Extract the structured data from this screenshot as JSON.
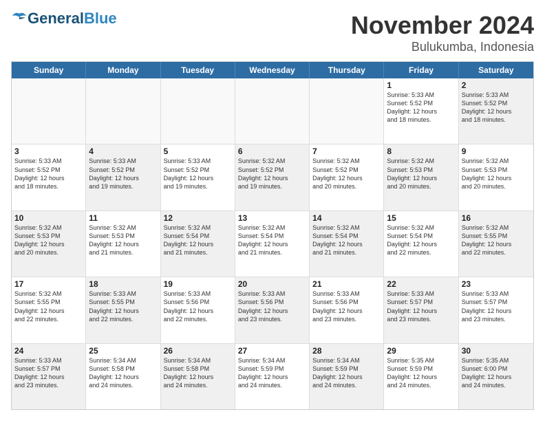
{
  "logo": {
    "text_general": "General",
    "text_blue": "Blue"
  },
  "title": "November 2024",
  "subtitle": "Bulukumba, Indonesia",
  "header_days": [
    "Sunday",
    "Monday",
    "Tuesday",
    "Wednesday",
    "Thursday",
    "Friday",
    "Saturday"
  ],
  "weeks": [
    [
      {
        "day": "",
        "info": "",
        "shaded": true
      },
      {
        "day": "",
        "info": "",
        "shaded": true
      },
      {
        "day": "",
        "info": "",
        "shaded": true
      },
      {
        "day": "",
        "info": "",
        "shaded": true
      },
      {
        "day": "",
        "info": "",
        "shaded": true
      },
      {
        "day": "1",
        "info": "Sunrise: 5:33 AM\nSunset: 5:52 PM\nDaylight: 12 hours\nand 18 minutes.",
        "shaded": false
      },
      {
        "day": "2",
        "info": "Sunrise: 5:33 AM\nSunset: 5:52 PM\nDaylight: 12 hours\nand 18 minutes.",
        "shaded": true
      }
    ],
    [
      {
        "day": "3",
        "info": "Sunrise: 5:33 AM\nSunset: 5:52 PM\nDaylight: 12 hours\nand 18 minutes.",
        "shaded": false
      },
      {
        "day": "4",
        "info": "Sunrise: 5:33 AM\nSunset: 5:52 PM\nDaylight: 12 hours\nand 19 minutes.",
        "shaded": true
      },
      {
        "day": "5",
        "info": "Sunrise: 5:33 AM\nSunset: 5:52 PM\nDaylight: 12 hours\nand 19 minutes.",
        "shaded": false
      },
      {
        "day": "6",
        "info": "Sunrise: 5:32 AM\nSunset: 5:52 PM\nDaylight: 12 hours\nand 19 minutes.",
        "shaded": true
      },
      {
        "day": "7",
        "info": "Sunrise: 5:32 AM\nSunset: 5:52 PM\nDaylight: 12 hours\nand 20 minutes.",
        "shaded": false
      },
      {
        "day": "8",
        "info": "Sunrise: 5:32 AM\nSunset: 5:53 PM\nDaylight: 12 hours\nand 20 minutes.",
        "shaded": true
      },
      {
        "day": "9",
        "info": "Sunrise: 5:32 AM\nSunset: 5:53 PM\nDaylight: 12 hours\nand 20 minutes.",
        "shaded": false
      }
    ],
    [
      {
        "day": "10",
        "info": "Sunrise: 5:32 AM\nSunset: 5:53 PM\nDaylight: 12 hours\nand 20 minutes.",
        "shaded": true
      },
      {
        "day": "11",
        "info": "Sunrise: 5:32 AM\nSunset: 5:53 PM\nDaylight: 12 hours\nand 21 minutes.",
        "shaded": false
      },
      {
        "day": "12",
        "info": "Sunrise: 5:32 AM\nSunset: 5:54 PM\nDaylight: 12 hours\nand 21 minutes.",
        "shaded": true
      },
      {
        "day": "13",
        "info": "Sunrise: 5:32 AM\nSunset: 5:54 PM\nDaylight: 12 hours\nand 21 minutes.",
        "shaded": false
      },
      {
        "day": "14",
        "info": "Sunrise: 5:32 AM\nSunset: 5:54 PM\nDaylight: 12 hours\nand 21 minutes.",
        "shaded": true
      },
      {
        "day": "15",
        "info": "Sunrise: 5:32 AM\nSunset: 5:54 PM\nDaylight: 12 hours\nand 22 minutes.",
        "shaded": false
      },
      {
        "day": "16",
        "info": "Sunrise: 5:32 AM\nSunset: 5:55 PM\nDaylight: 12 hours\nand 22 minutes.",
        "shaded": true
      }
    ],
    [
      {
        "day": "17",
        "info": "Sunrise: 5:32 AM\nSunset: 5:55 PM\nDaylight: 12 hours\nand 22 minutes.",
        "shaded": false
      },
      {
        "day": "18",
        "info": "Sunrise: 5:33 AM\nSunset: 5:55 PM\nDaylight: 12 hours\nand 22 minutes.",
        "shaded": true
      },
      {
        "day": "19",
        "info": "Sunrise: 5:33 AM\nSunset: 5:56 PM\nDaylight: 12 hours\nand 22 minutes.",
        "shaded": false
      },
      {
        "day": "20",
        "info": "Sunrise: 5:33 AM\nSunset: 5:56 PM\nDaylight: 12 hours\nand 23 minutes.",
        "shaded": true
      },
      {
        "day": "21",
        "info": "Sunrise: 5:33 AM\nSunset: 5:56 PM\nDaylight: 12 hours\nand 23 minutes.",
        "shaded": false
      },
      {
        "day": "22",
        "info": "Sunrise: 5:33 AM\nSunset: 5:57 PM\nDaylight: 12 hours\nand 23 minutes.",
        "shaded": true
      },
      {
        "day": "23",
        "info": "Sunrise: 5:33 AM\nSunset: 5:57 PM\nDaylight: 12 hours\nand 23 minutes.",
        "shaded": false
      }
    ],
    [
      {
        "day": "24",
        "info": "Sunrise: 5:33 AM\nSunset: 5:57 PM\nDaylight: 12 hours\nand 23 minutes.",
        "shaded": true
      },
      {
        "day": "25",
        "info": "Sunrise: 5:34 AM\nSunset: 5:58 PM\nDaylight: 12 hours\nand 24 minutes.",
        "shaded": false
      },
      {
        "day": "26",
        "info": "Sunrise: 5:34 AM\nSunset: 5:58 PM\nDaylight: 12 hours\nand 24 minutes.",
        "shaded": true
      },
      {
        "day": "27",
        "info": "Sunrise: 5:34 AM\nSunset: 5:59 PM\nDaylight: 12 hours\nand 24 minutes.",
        "shaded": false
      },
      {
        "day": "28",
        "info": "Sunrise: 5:34 AM\nSunset: 5:59 PM\nDaylight: 12 hours\nand 24 minutes.",
        "shaded": true
      },
      {
        "day": "29",
        "info": "Sunrise: 5:35 AM\nSunset: 5:59 PM\nDaylight: 12 hours\nand 24 minutes.",
        "shaded": false
      },
      {
        "day": "30",
        "info": "Sunrise: 5:35 AM\nSunset: 6:00 PM\nDaylight: 12 hours\nand 24 minutes.",
        "shaded": true
      }
    ]
  ]
}
